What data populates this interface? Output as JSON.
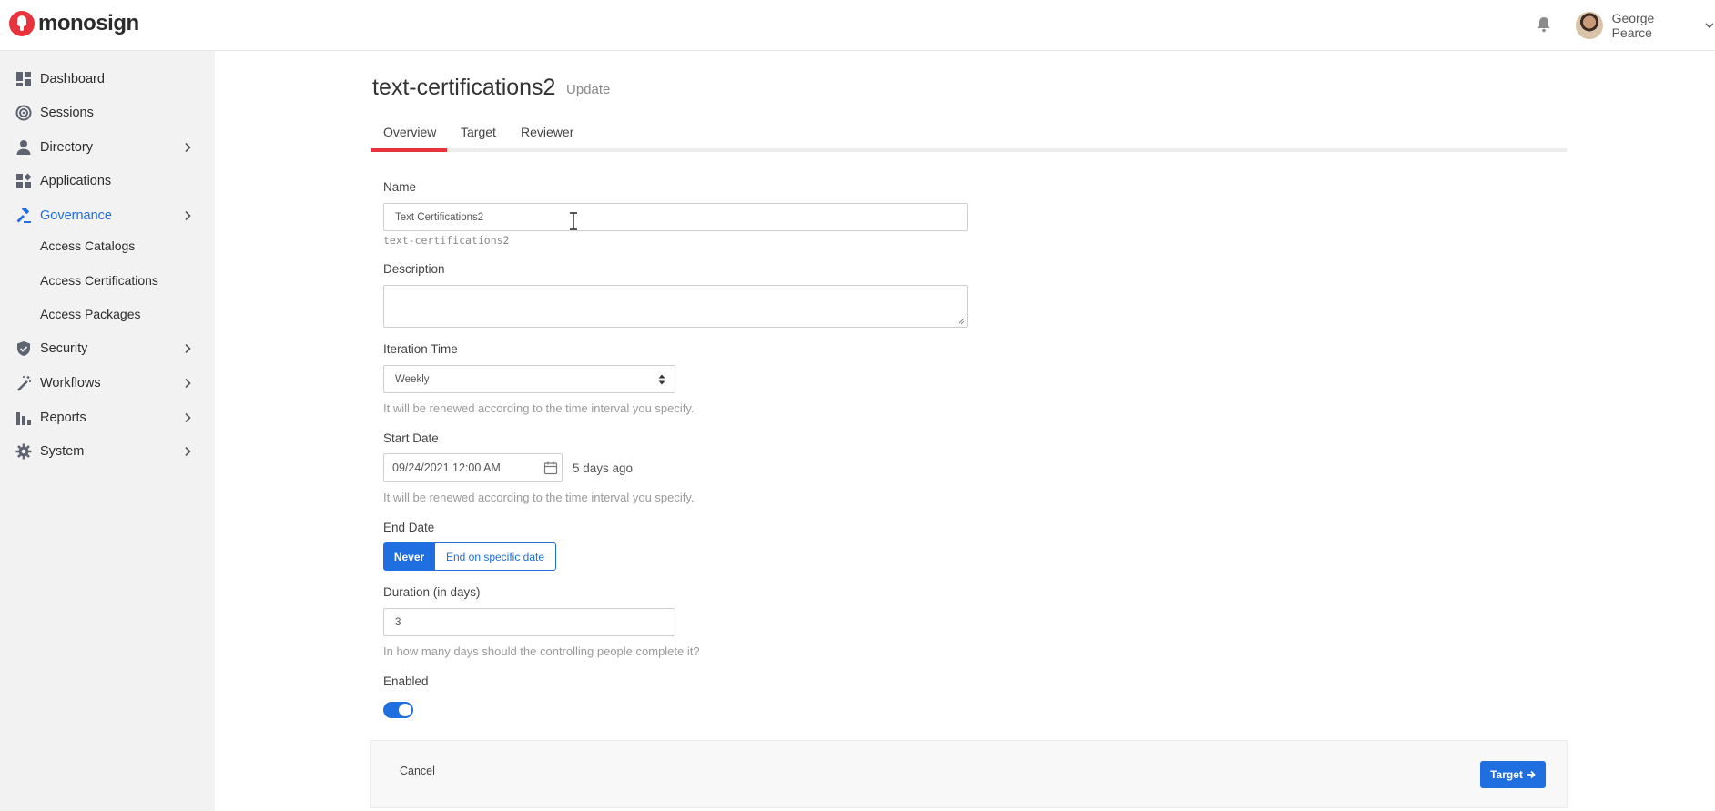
{
  "header": {
    "brand": "monosign",
    "user_name": "George Pearce"
  },
  "sidebar": {
    "items": [
      {
        "label": "Dashboard",
        "icon": "dashboard-icon"
      },
      {
        "label": "Sessions",
        "icon": "sessions-icon"
      },
      {
        "label": "Directory",
        "icon": "user-icon"
      },
      {
        "label": "Applications",
        "icon": "apps-icon"
      },
      {
        "label": "Governance",
        "icon": "gavel-icon"
      },
      {
        "label": "Security",
        "icon": "shield-icon"
      },
      {
        "label": "Workflows",
        "icon": "wand-icon"
      },
      {
        "label": "Reports",
        "icon": "bar-chart-icon"
      },
      {
        "label": "System",
        "icon": "gear-icon"
      }
    ],
    "governance_sub": [
      "Access Catalogs",
      "Access Certifications",
      "Access Packages"
    ]
  },
  "page": {
    "title": "text-certifications2",
    "subtitle": "Update"
  },
  "tabs": [
    "Overview",
    "Target",
    "Reviewer"
  ],
  "form": {
    "name_label": "Name",
    "name_value": "Text Certifications2",
    "name_slug": "text-certifications2",
    "description_label": "Description",
    "iteration_label": "Iteration Time",
    "iteration_value": "Weekly",
    "iteration_help": "It will be renewed according to the time interval you specify.",
    "start_label": "Start Date",
    "start_value": "09/24/2021 12:00 AM",
    "start_relative": "5 days ago",
    "start_help": "It will be renewed according to the time interval you specify.",
    "end_label": "End Date",
    "end_option_never": "Never",
    "end_option_specific": "End on specific date",
    "duration_label": "Duration (in days)",
    "duration_value": "3",
    "duration_help": "In how many days should the controlling people complete it?",
    "enabled_label": "Enabled"
  },
  "footer": {
    "cancel_label": "Cancel",
    "next_label": "Target"
  },
  "colors": {
    "accent": "#1f6fe0",
    "brand_red": "#e8323c"
  }
}
